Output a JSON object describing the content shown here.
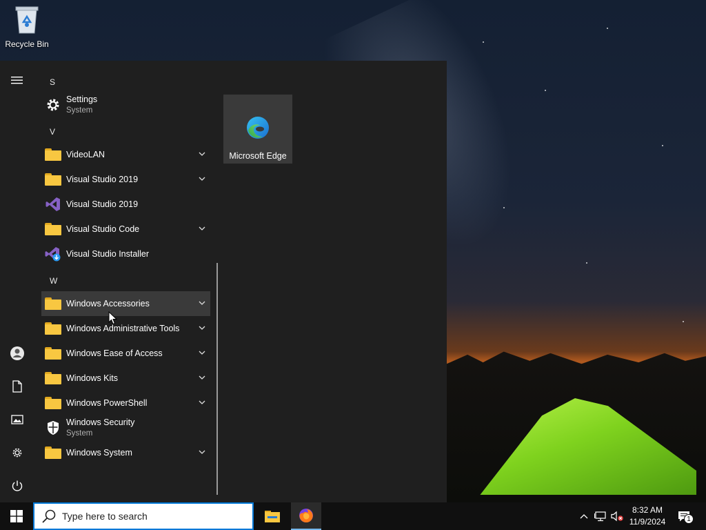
{
  "desktop": {
    "recycle_bin_label": "Recycle Bin"
  },
  "start_menu": {
    "sections": {
      "s": "S",
      "v": "V",
      "w": "W"
    },
    "items": [
      {
        "label": "Settings",
        "sub": "System",
        "icon": "gear-icon"
      },
      {
        "label": "VideoLAN",
        "icon": "folder-icon",
        "expandable": true
      },
      {
        "label": "Visual Studio 2019",
        "icon": "folder-icon",
        "expandable": true
      },
      {
        "label": "Visual Studio 2019",
        "icon": "visual-studio-icon"
      },
      {
        "label": "Visual Studio Code",
        "icon": "folder-icon",
        "expandable": true
      },
      {
        "label": "Visual Studio Installer",
        "icon": "visual-studio-installer-icon"
      },
      {
        "label": "Windows Accessories",
        "icon": "folder-icon",
        "expandable": true
      },
      {
        "label": "Windows Administrative Tools",
        "icon": "folder-icon",
        "expandable": true
      },
      {
        "label": "Windows Ease of Access",
        "icon": "folder-icon",
        "expandable": true
      },
      {
        "label": "Windows Kits",
        "icon": "folder-icon",
        "expandable": true
      },
      {
        "label": "Windows PowerShell",
        "icon": "folder-icon",
        "expandable": true
      },
      {
        "label": "Windows Security",
        "sub": "System",
        "icon": "shield-icon"
      },
      {
        "label": "Windows System",
        "icon": "folder-icon",
        "expandable": true
      }
    ],
    "tiles": [
      {
        "label": "Microsoft Edge",
        "icon": "edge-icon"
      }
    ]
  },
  "taskbar": {
    "search_placeholder": "Type here to search",
    "clock_time": "8:32 AM",
    "clock_date": "11/9/2024",
    "notification_count": "1"
  },
  "colors": {
    "accent": "#0078d7",
    "menu_bg": "#1f1f1f",
    "folder": "#f8c741"
  }
}
